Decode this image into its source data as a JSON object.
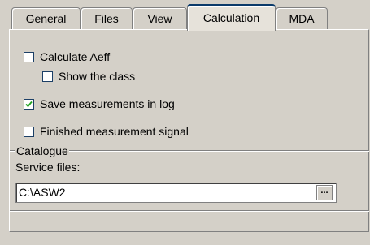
{
  "tabs": [
    {
      "label": "General",
      "active": false
    },
    {
      "label": "Files",
      "active": false
    },
    {
      "label": "View",
      "active": false
    },
    {
      "label": "Calculation",
      "active": true
    },
    {
      "label": "MDA",
      "active": false
    }
  ],
  "options": {
    "calculate_aeff": {
      "label": "Calculate Aeff",
      "checked": false
    },
    "show_class": {
      "label": "Show the class",
      "checked": false
    },
    "save_measurements": {
      "label": "Save measurements in log",
      "checked": true
    },
    "finished_signal": {
      "label": "Finished measurement signal",
      "checked": false
    }
  },
  "catalogue": {
    "legend": "Catalogue",
    "service_files_label": "Service files:",
    "service_files_value": "C:\\ASW2",
    "browse_label": "..."
  },
  "colors": {
    "background": "#d4d0c8",
    "active_tab_accent": "#0a3a6a",
    "checkbox_border": "#1c3f66"
  }
}
